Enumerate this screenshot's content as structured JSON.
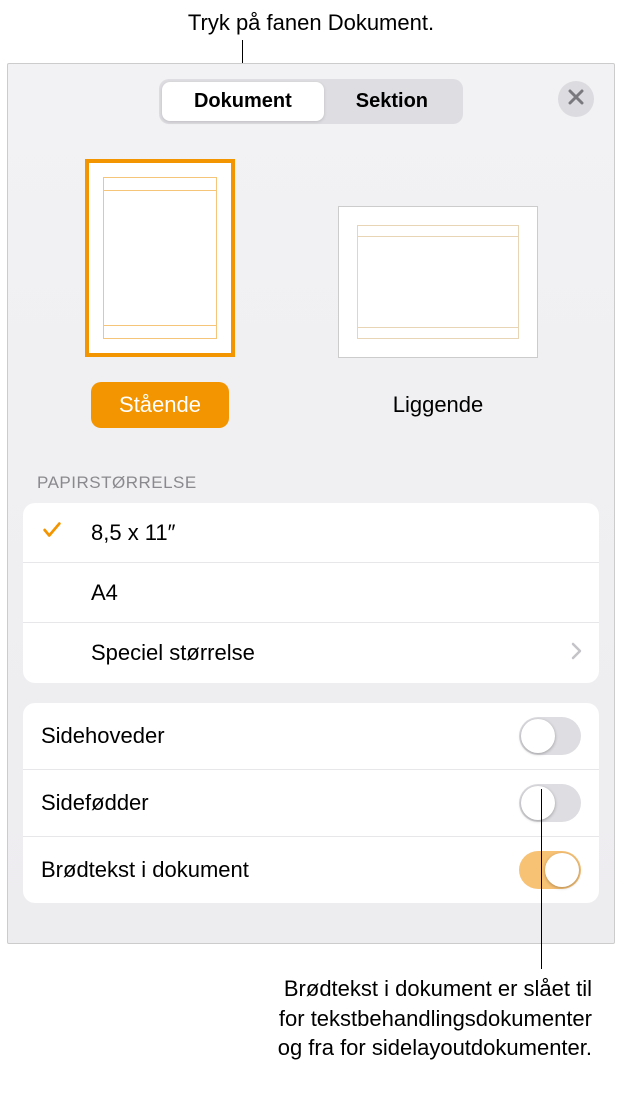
{
  "callouts": {
    "top": "Tryk på fanen Dokument.",
    "bottom_line1": "Brødtekst i dokument er slået til",
    "bottom_line2": "for tekstbehandlingsdokumenter",
    "bottom_line3": "og fra for sidelayoutdokumenter."
  },
  "tabs": {
    "document": "Dokument",
    "section": "Sektion"
  },
  "orientation": {
    "portrait": "Stående",
    "landscape": "Liggende"
  },
  "paperSize": {
    "header": "PAPIRSTØRRELSE",
    "letter": "8,5 x 11″",
    "a4": "A4",
    "custom": "Speciel størrelse"
  },
  "switches": {
    "headers": "Sidehoveder",
    "footers": "Sidefødder",
    "bodyText": "Brødtekst i dokument"
  }
}
